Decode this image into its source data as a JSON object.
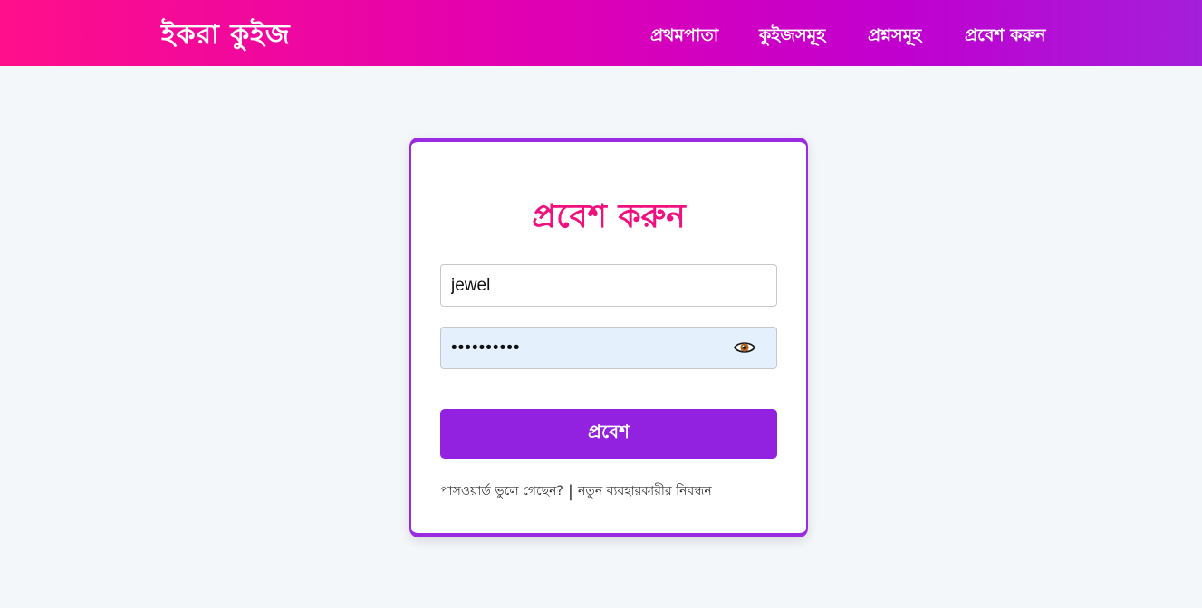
{
  "header": {
    "brand": "ইকরা কুইজ",
    "nav": {
      "home": "প্রথমপাতা",
      "quizzes": "কুইজসমূহ",
      "questions": "প্রশ্নসমূহ",
      "login": "প্রবেশ করুন"
    }
  },
  "login_form": {
    "title": "প্রবেশ করুন",
    "username_value": "jewel",
    "password_value": "••••••••••",
    "show_password_icon": "eye-icon",
    "submit_label": "প্রবেশ",
    "forgot_password": "পাসওয়ার্ড ভুলে গেছেন?",
    "separator": "|",
    "register": "নতুন ব্যবহারকারীর নিবন্ধন"
  },
  "colors": {
    "header_gradient_start": "#ff0f8a",
    "header_gradient_end": "#a41fd9",
    "title": "#f0107e",
    "button": "#9321e0",
    "card_border": "#9b2be0",
    "password_bg": "#e5f0fd"
  }
}
